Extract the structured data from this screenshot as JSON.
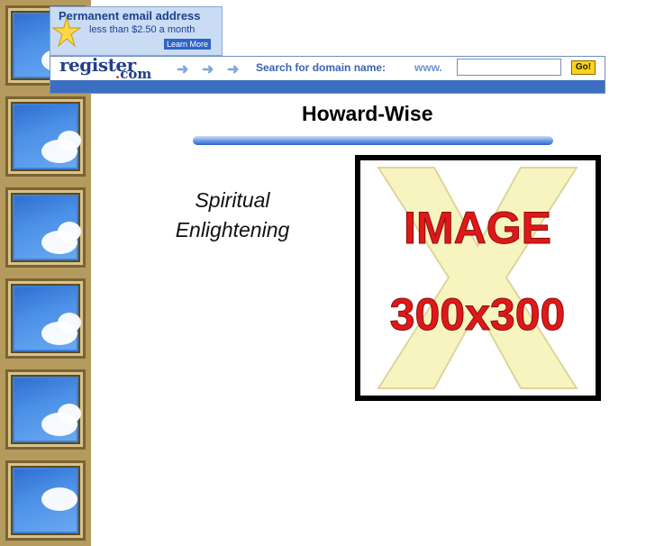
{
  "promo": {
    "title": "Permanent email address",
    "subtitle": "less than $2.50 a month",
    "link": "Learn More"
  },
  "search_bar": {
    "logo_main": "register",
    "logo_dot": ".",
    "logo_com": "com",
    "label": "Search for domain name:",
    "prefix": "www.",
    "input_value": "",
    "button_label": "Go!"
  },
  "main": {
    "title": "Howard-Wise",
    "tagline_line1": "Spiritual",
    "tagline_line2": "Enlightening",
    "image_text_line1": "IMAGE",
    "image_text_line2": "300x300"
  },
  "colors": {
    "brand_blue": "#223f88",
    "bar_blue": "#3c6fc2",
    "go_yellow": "#ffd21c",
    "image_red": "#e01818",
    "image_x_fill": "#f7f4c0"
  },
  "icons": [
    "star-icon",
    "arrow-right-icon"
  ]
}
